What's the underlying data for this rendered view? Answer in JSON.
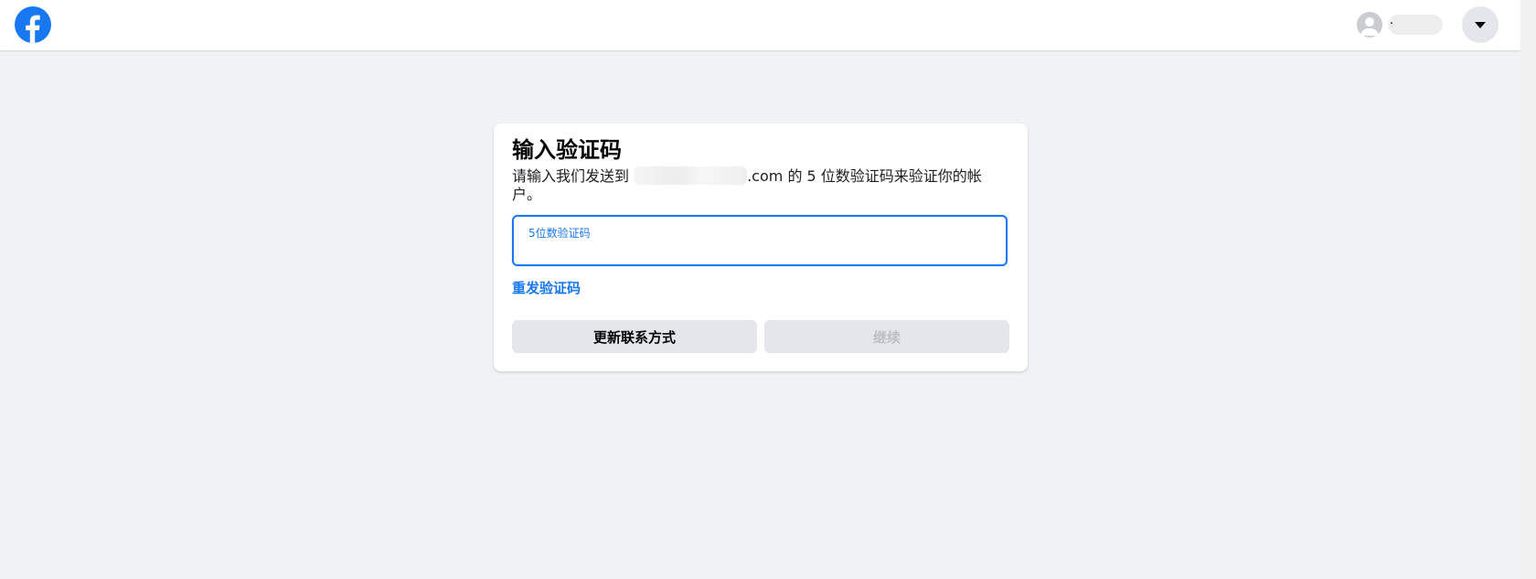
{
  "header": {
    "profile_name": "·"
  },
  "card": {
    "title": "输入验证码",
    "desc_before": "请输入我们发送到 ",
    "desc_after": ".com 的 5 位数验证码来验证你的帐户。",
    "code_label": "5位数验证码",
    "code_value": "",
    "resend_link": "重发验证码",
    "update_contact_button": "更新联系方式",
    "continue_button": "继续"
  },
  "colors": {
    "brand": "#1877f2",
    "background": "#f0f2f5",
    "button_bg": "#e4e6eb",
    "disabled_text": "#bcc0c4"
  },
  "icons": {
    "logo": "facebook-logo-icon",
    "avatar": "user-silhouette-icon",
    "menu": "caret-down-icon"
  }
}
